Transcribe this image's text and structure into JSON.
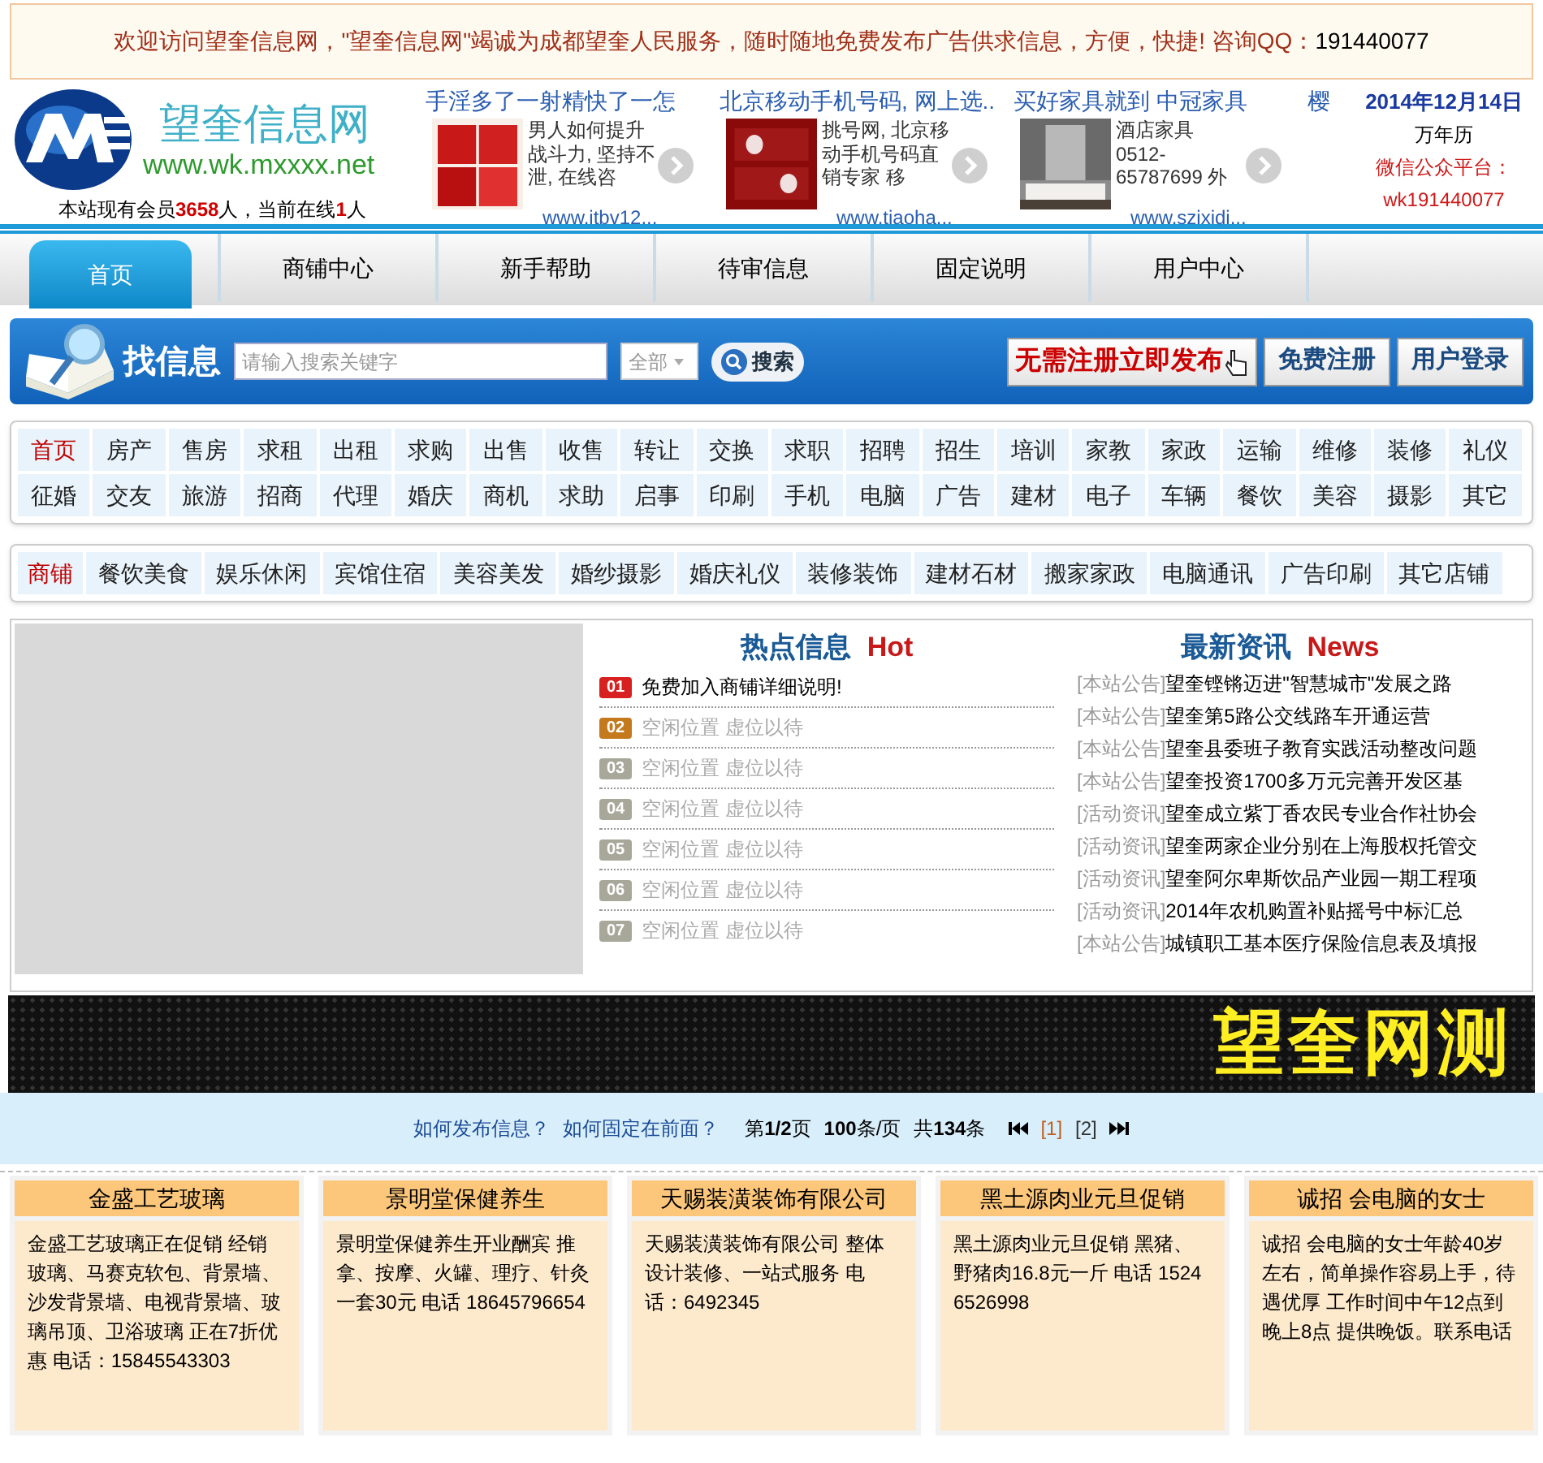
{
  "notice": {
    "text": "欢迎访问望奎信息网，\"望奎信息网\"竭诚为成都望奎人民服务，随时随地免费发布广告供求信息，方便，快捷! 咨询QQ：",
    "qq": "191440077"
  },
  "header": {
    "site_name": "望奎信息网",
    "url": "www.wk.mxxxx.net",
    "stats": "本站现有会员**3658**人，当前在线**1**人",
    "ads": [
      {
        "title": "手淫多了一射精快了一怎",
        "desc": "男人如何提升战斗力, 坚持不泄, 在线咨",
        "link": "www.itbv12..."
      },
      {
        "title": "北京移动手机号码, 网上选..",
        "desc": "挑号网, 北京移动手机号码直销专家 移",
        "link": "www.tiaoha..."
      },
      {
        "title": "买好家具就到 中冠家具",
        "desc": "酒店家具 0512-65787699 外",
        "link": "www.szixidi..."
      },
      {
        "title": "樱"
      }
    ],
    "date": "2014年12月14日",
    "calendar": "万年历",
    "wechat_label": "微信公众平台：",
    "wechat_id": "wk191440077"
  },
  "nav": [
    {
      "label": "首页",
      "selected": true
    },
    {
      "label": "商铺中心",
      "selected": false
    },
    {
      "label": "新手帮助",
      "selected": false
    },
    {
      "label": "待审信息",
      "selected": false
    },
    {
      "label": "固定说明",
      "selected": false
    },
    {
      "label": "用户中心",
      "selected": false
    }
  ],
  "search": {
    "title": "找信息",
    "placeholder": "请输入搜索关键字",
    "scope": "全部",
    "button": "搜索",
    "publish": "无需注册立即发布",
    "register": "免费注册",
    "login": "用户登录"
  },
  "categories": [
    {
      "label": "首页",
      "selected": true
    },
    {
      "label": "房产",
      "selected": false
    },
    {
      "label": "售房",
      "selected": false
    },
    {
      "label": "求租",
      "selected": false
    },
    {
      "label": "出租",
      "selected": false
    },
    {
      "label": "求购",
      "selected": false
    },
    {
      "label": "出售",
      "selected": false
    },
    {
      "label": "收售",
      "selected": false
    },
    {
      "label": "转让",
      "selected": false
    },
    {
      "label": "交换",
      "selected": false
    },
    {
      "label": "求职",
      "selected": false
    },
    {
      "label": "招聘",
      "selected": false
    },
    {
      "label": "招生",
      "selected": false
    },
    {
      "label": "培训",
      "selected": false
    },
    {
      "label": "家教",
      "selected": false
    },
    {
      "label": "家政",
      "selected": false
    },
    {
      "label": "运输",
      "selected": false
    },
    {
      "label": "维修",
      "selected": false
    },
    {
      "label": "装修",
      "selected": false
    },
    {
      "label": "礼仪",
      "selected": false
    },
    {
      "label": "征婚",
      "selected": false
    },
    {
      "label": "交友",
      "selected": false
    },
    {
      "label": "旅游",
      "selected": false
    },
    {
      "label": "招商",
      "selected": false
    },
    {
      "label": "代理",
      "selected": false
    },
    {
      "label": "婚庆",
      "selected": false
    },
    {
      "label": "商机",
      "selected": false
    },
    {
      "label": "求助",
      "selected": false
    },
    {
      "label": "启事",
      "selected": false
    },
    {
      "label": "印刷",
      "selected": false
    },
    {
      "label": "手机",
      "selected": false
    },
    {
      "label": "电脑",
      "selected": false
    },
    {
      "label": "广告",
      "selected": false
    },
    {
      "label": "建材",
      "selected": false
    },
    {
      "label": "电子",
      "selected": false
    },
    {
      "label": "车辆",
      "selected": false
    },
    {
      "label": "餐饮",
      "selected": false
    },
    {
      "label": "美容",
      "selected": false
    },
    {
      "label": "摄影",
      "selected": false
    },
    {
      "label": "其它",
      "selected": false
    }
  ],
  "shop_categories": [
    {
      "label": "商铺",
      "selected": true
    },
    {
      "label": "餐饮美食",
      "selected": false
    },
    {
      "label": "娱乐休闲",
      "selected": false
    },
    {
      "label": "宾馆住宿",
      "selected": false
    },
    {
      "label": "美容美发",
      "selected": false
    },
    {
      "label": "婚纱摄影",
      "selected": false
    },
    {
      "label": "婚庆礼仪",
      "selected": false
    },
    {
      "label": "装修装饰",
      "selected": false
    },
    {
      "label": "建材石材",
      "selected": false
    },
    {
      "label": "搬家家政",
      "selected": false
    },
    {
      "label": "电脑通讯",
      "selected": false
    },
    {
      "label": "广告印刷",
      "selected": false
    },
    {
      "label": "其它店铺",
      "selected": false
    }
  ],
  "hot": {
    "title": "热点信息",
    "title_en": "Hot",
    "items": [
      {
        "num": "01",
        "color": "#d92020",
        "text": "免费加入商铺详细说明!",
        "vacant": false
      },
      {
        "num": "02",
        "color": "#c47a1c",
        "text": "空闲位置 虚位以待",
        "vacant": true
      },
      {
        "num": "03",
        "color": "#a8a89a",
        "text": "空闲位置 虚位以待",
        "vacant": true
      },
      {
        "num": "04",
        "color": "#a8a89a",
        "text": "空闲位置 虚位以待",
        "vacant": true
      },
      {
        "num": "05",
        "color": "#a8a89a",
        "text": "空闲位置 虚位以待",
        "vacant": true
      },
      {
        "num": "06",
        "color": "#a8a89a",
        "text": "空闲位置 虚位以待",
        "vacant": true
      },
      {
        "num": "07",
        "color": "#a8a89a",
        "text": "空闲位置 虚位以待",
        "vacant": true
      }
    ]
  },
  "news": {
    "title": "最新资讯",
    "title_en": "News",
    "items": [
      {
        "tag": "[本站公告]",
        "text": "望奎铿锵迈进\"智慧城市\"发展之路"
      },
      {
        "tag": "[本站公告]",
        "text": "望奎第5路公交线路车开通运营"
      },
      {
        "tag": "[本站公告]",
        "text": "望奎县委班子教育实践活动整改问题"
      },
      {
        "tag": "[本站公告]",
        "text": "望奎投资1700多万元完善开发区基"
      },
      {
        "tag": "[活动资讯]",
        "text": "望奎成立紫丁香农民专业合作社协会"
      },
      {
        "tag": "[活动资讯]",
        "text": "望奎两家企业分别在上海股权托管交"
      },
      {
        "tag": "[活动资讯]",
        "text": "望奎阿尔卑斯饮品产业园一期工程项"
      },
      {
        "tag": "[活动资讯]",
        "text": "2014年农机购置补贴摇号中标汇总"
      },
      {
        "tag": "[本站公告]",
        "text": "城镇职工基本医疗保险信息表及填报"
      }
    ]
  },
  "marquee": "望奎网测",
  "pager": {
    "links": [
      "如何发布信息？",
      "如何固定在前面？"
    ],
    "page": "第**1/2**页",
    "per_page": "**100**条/页",
    "total": "共**134**条",
    "pages": [
      {
        "label": "[1]",
        "selected": true
      },
      {
        "label": "[2]",
        "selected": false
      }
    ]
  },
  "cards": [
    {
      "title": "金盛工艺玻璃",
      "body": "金盛工艺玻璃正在促销 经销玻璃、马赛克软包、背景墙、沙发背景墙、电视背景墙、玻璃吊顶、卫浴玻璃 正在7折优惠 电话：15845543303"
    },
    {
      "title": "景明堂保健养生",
      "body": "景明堂保健养生开业酬宾 推拿、按摩、火罐、理疗、针灸一套30元 电话 18645796654"
    },
    {
      "title": "天赐装潢装饰有限公司",
      "body": "天赐装潢装饰有限公司 整体设计装修、一站式服务 电话：6492345"
    },
    {
      "title": "黑土源肉业元旦促销",
      "body": "黑土源肉业元旦促销 黑猪、野猪肉16.8元一斤 电话 15246526998"
    },
    {
      "title": "诚招 会电脑的女士",
      "body": "诚招 会电脑的女士年龄40岁左右，简单操作容易上手，待遇优厚 工作时间中午12点到晚上8点 提供晚饭。联系电话"
    }
  ]
}
